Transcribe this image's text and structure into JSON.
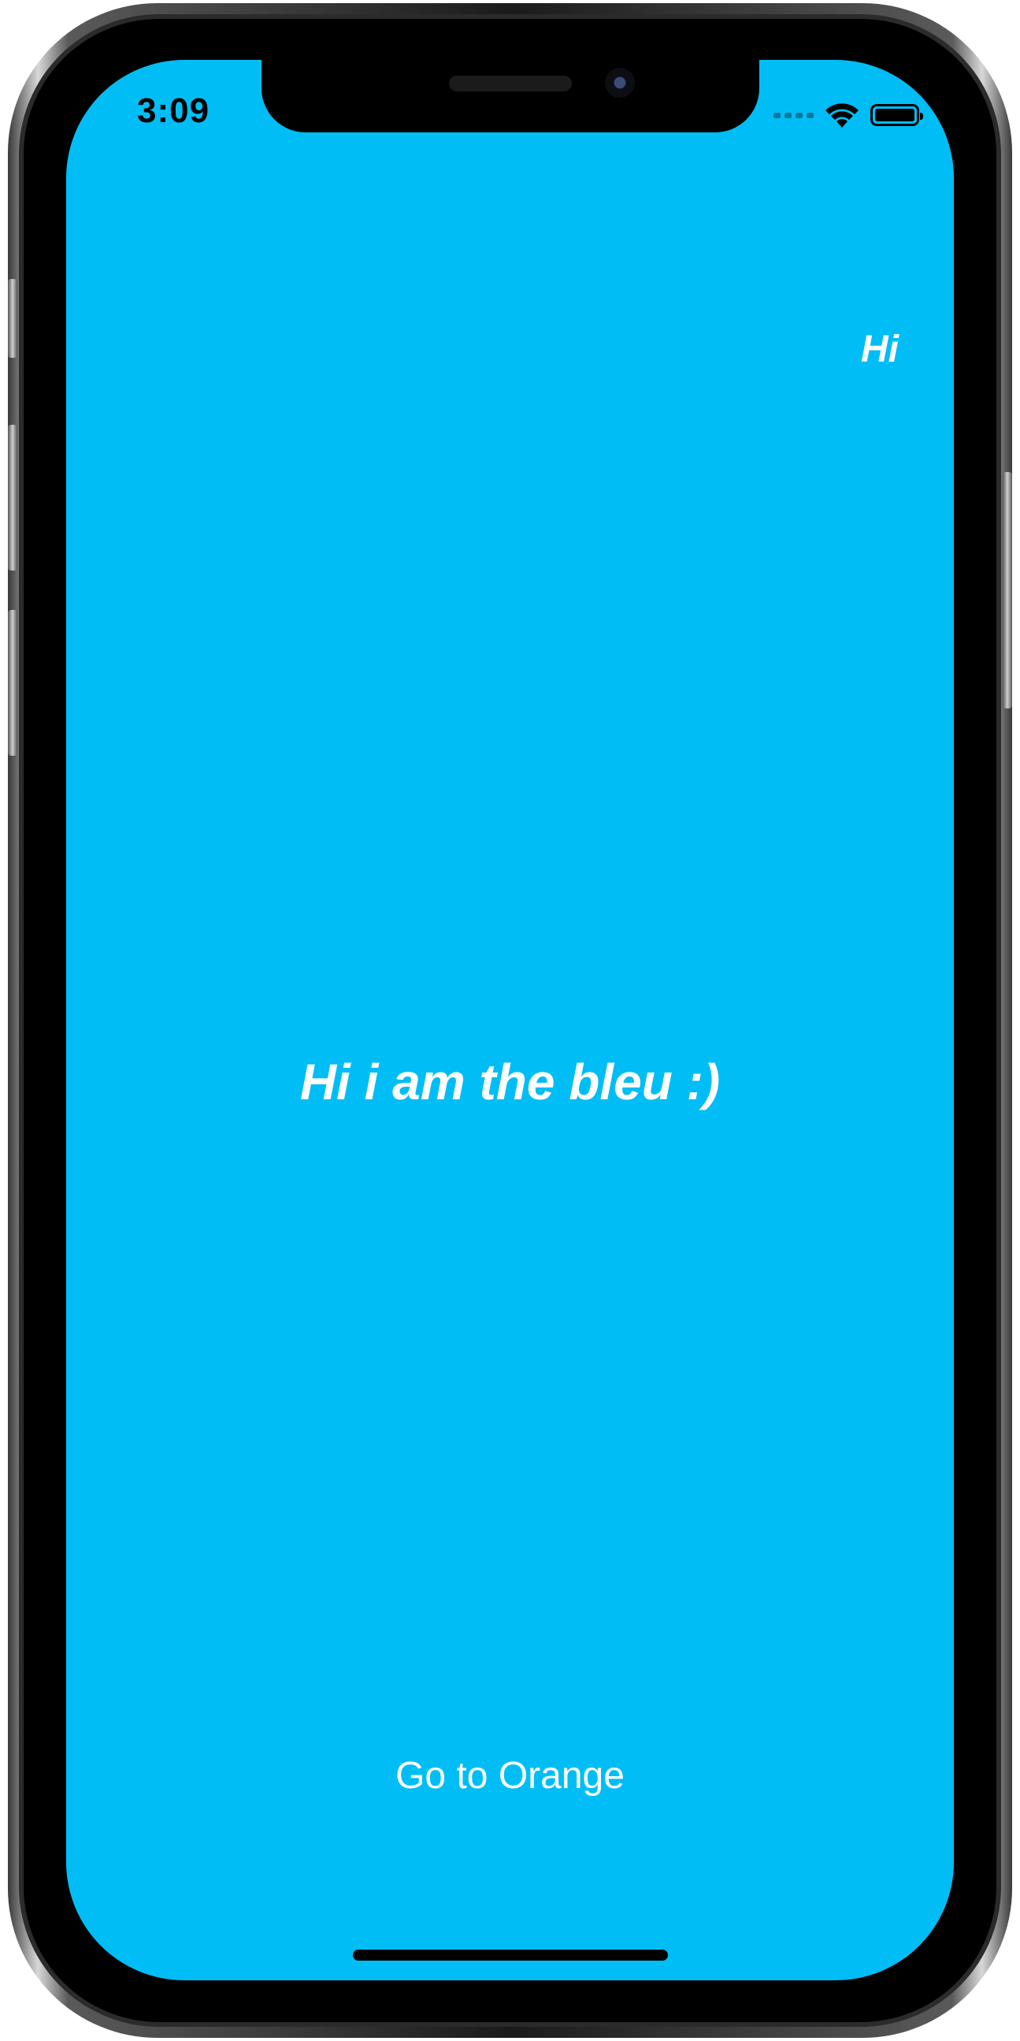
{
  "status_bar": {
    "time": "3:09",
    "wifi_icon": "wifi-icon",
    "battery_icon": "battery-icon"
  },
  "nav": {
    "right_button_label": "Hi"
  },
  "main": {
    "title": "Hi i am the bleu :)"
  },
  "actions": {
    "go_button_label": "Go to Orange"
  },
  "colors": {
    "screen_background": "#00bef5",
    "text": "#ffffff"
  }
}
